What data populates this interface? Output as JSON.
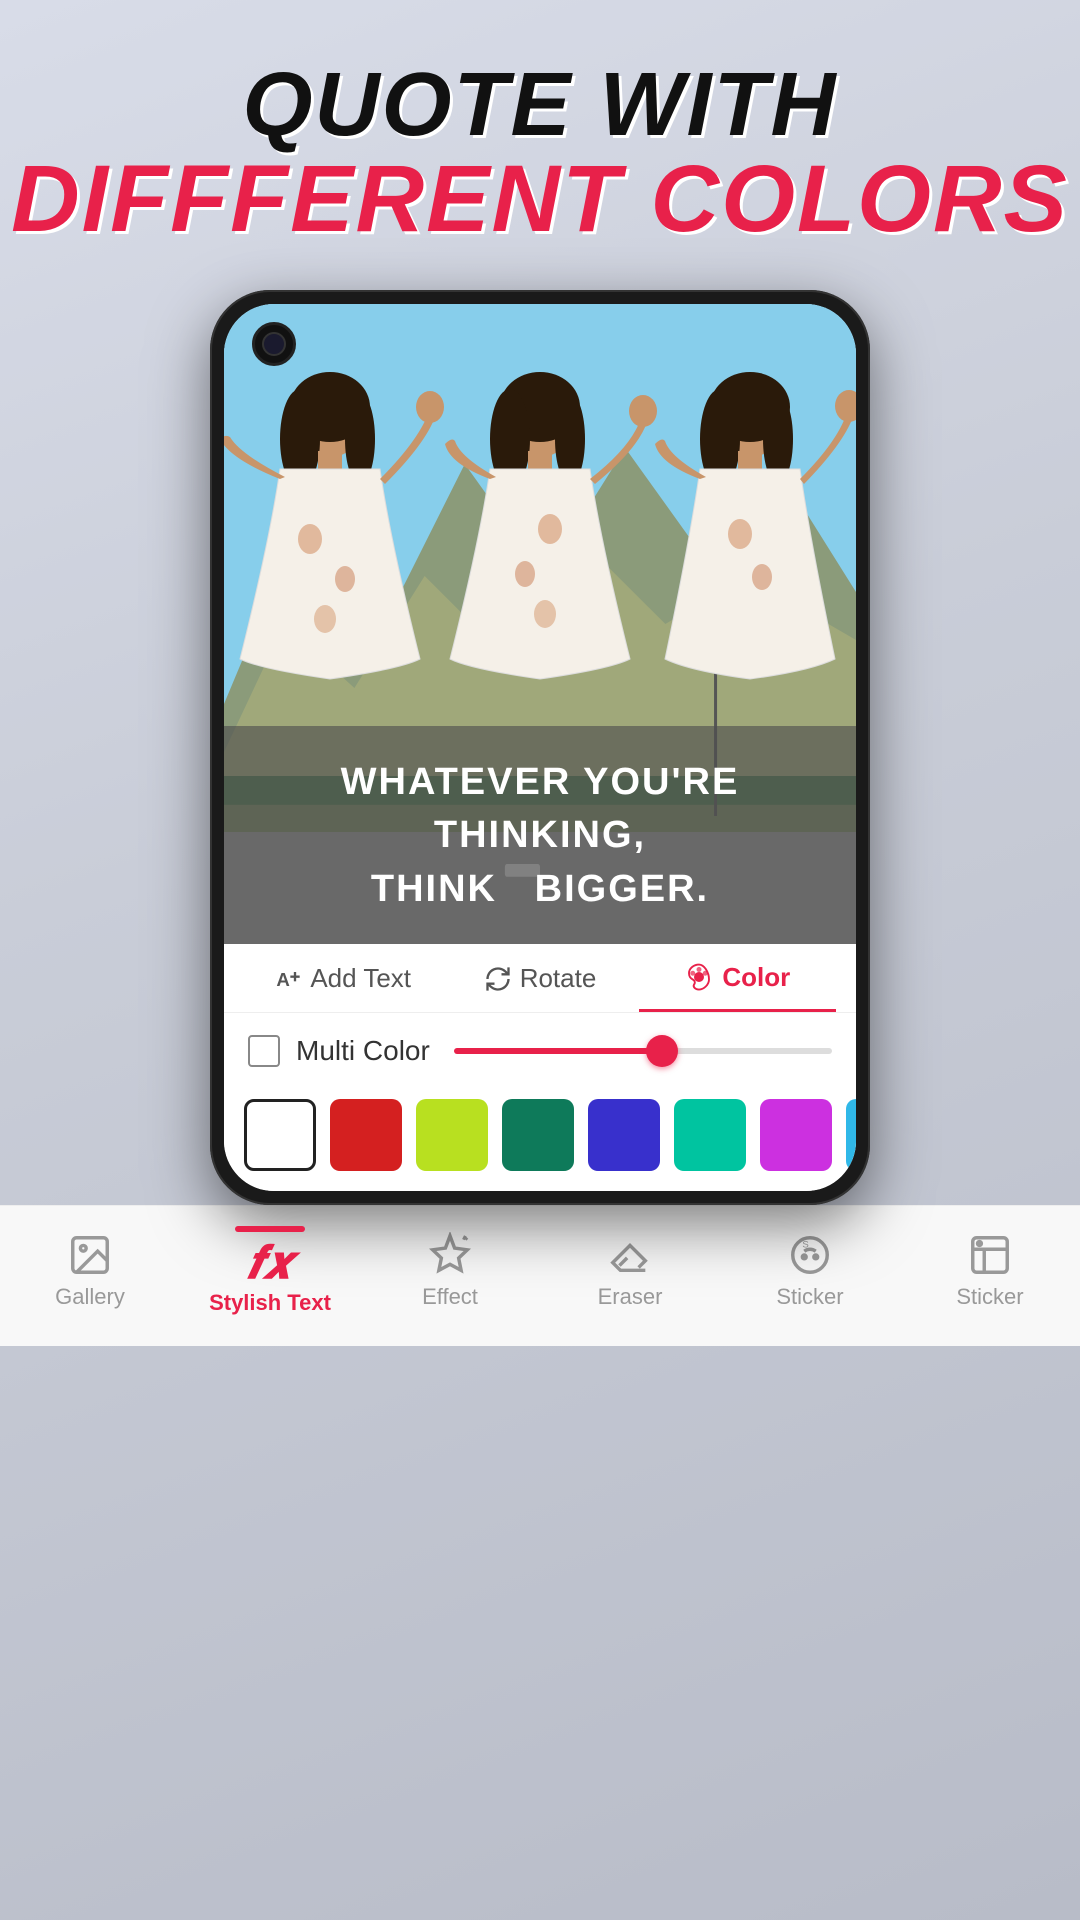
{
  "header": {
    "line1": "QUOTE WITH",
    "line2": "DIFFFERENT COLORS"
  },
  "quote": {
    "text": "WHATEVER YOU'RE THINKING,\nTHINK  BIGGER."
  },
  "tabs": {
    "items": [
      {
        "id": "add-text",
        "label": "Add Text",
        "active": false
      },
      {
        "id": "rotate",
        "label": "Rotate",
        "active": false
      },
      {
        "id": "color",
        "label": "Color",
        "active": true
      }
    ]
  },
  "multi_color": {
    "label": "Multi Color",
    "slider_value": 55
  },
  "swatches": [
    {
      "color": "#ffffff",
      "selected": true
    },
    {
      "color": "#d42020",
      "selected": false
    },
    {
      "color": "#b8e020",
      "selected": false
    },
    {
      "color": "#0e7a5a",
      "selected": false
    },
    {
      "color": "#3830cc",
      "selected": false
    },
    {
      "color": "#00c4a0",
      "selected": false
    },
    {
      "color": "#cc30e0",
      "selected": false
    },
    {
      "color": "#30b8e8",
      "selected": false
    },
    {
      "color": "#e820a0",
      "selected": false
    }
  ],
  "nav": {
    "items": [
      {
        "id": "gallery",
        "label": "Gallery",
        "icon": "gallery",
        "active": false
      },
      {
        "id": "stylish-text",
        "label": "Stylish Text",
        "icon": "fx",
        "active": true
      },
      {
        "id": "effect",
        "label": "Effect",
        "icon": "sparkle",
        "active": false
      },
      {
        "id": "eraser",
        "label": "Eraser",
        "icon": "eraser",
        "active": false
      },
      {
        "id": "sticker",
        "label": "Sticker",
        "icon": "sticker",
        "active": false
      },
      {
        "id": "sticker2",
        "label": "Sticker",
        "icon": "sticker2",
        "active": false
      }
    ]
  }
}
